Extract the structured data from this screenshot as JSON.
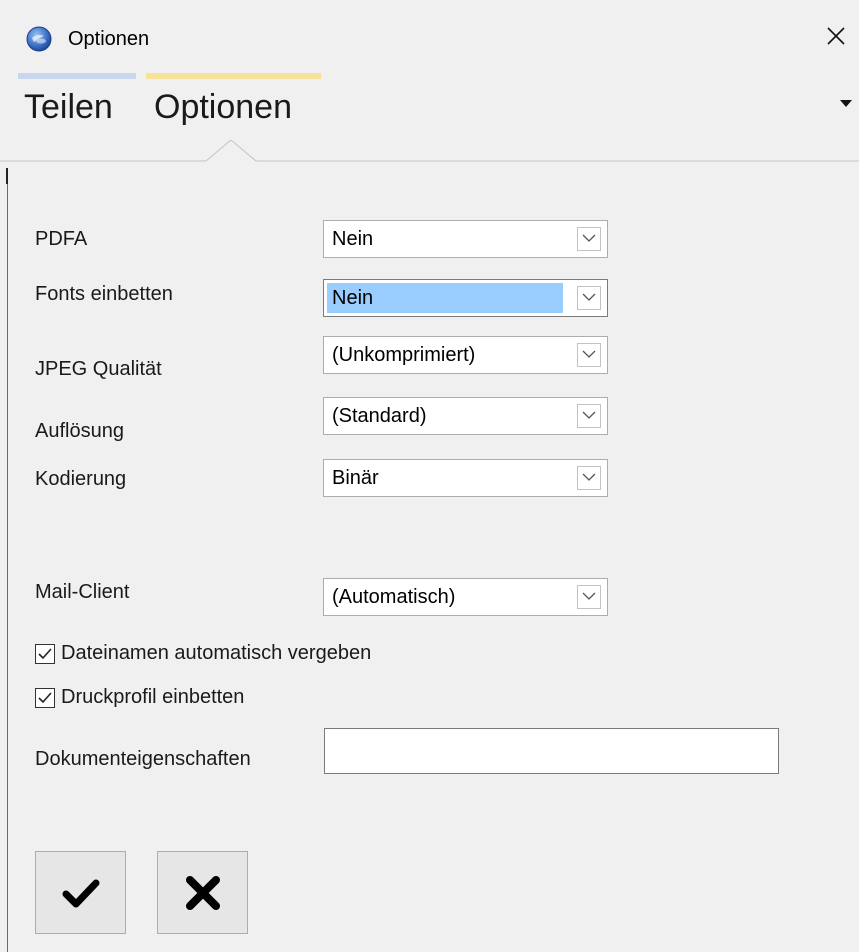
{
  "window": {
    "title": "Optionen",
    "icon": "app-globe-icon",
    "close_icon": "close-icon"
  },
  "tabs": [
    {
      "label": "Teilen",
      "accent": "#c8d6ee",
      "active": false
    },
    {
      "label": "Optionen",
      "accent": "#f7e29a",
      "active": true
    }
  ],
  "tab_menu_icon": "dropdown-caret-icon",
  "form": {
    "pdfa": {
      "label": "PDFA",
      "value": "Nein"
    },
    "fonts": {
      "label": "Fonts einbetten",
      "value": "Nein",
      "highlight_color": "#99ccff"
    },
    "jpeg": {
      "label": "JPEG Qualität",
      "value": "(Unkomprimiert)"
    },
    "resolution": {
      "label": "Auflösung",
      "value": "(Standard)"
    },
    "encoding": {
      "label": "Kodierung",
      "value": "Binär"
    },
    "mail_client": {
      "label": "Mail-Client",
      "value": "(Automatisch)"
    },
    "auto_filenames": {
      "label": "Dateinamen automatisch vergeben",
      "checked": true
    },
    "embed_print_profile": {
      "label": "Druckprofil einbetten",
      "checked": true
    },
    "doc_properties": {
      "label": "Dokumenteigenschaften",
      "value": ""
    }
  },
  "buttons": {
    "ok_icon": "checkmark-icon",
    "cancel_icon": "cross-icon"
  }
}
